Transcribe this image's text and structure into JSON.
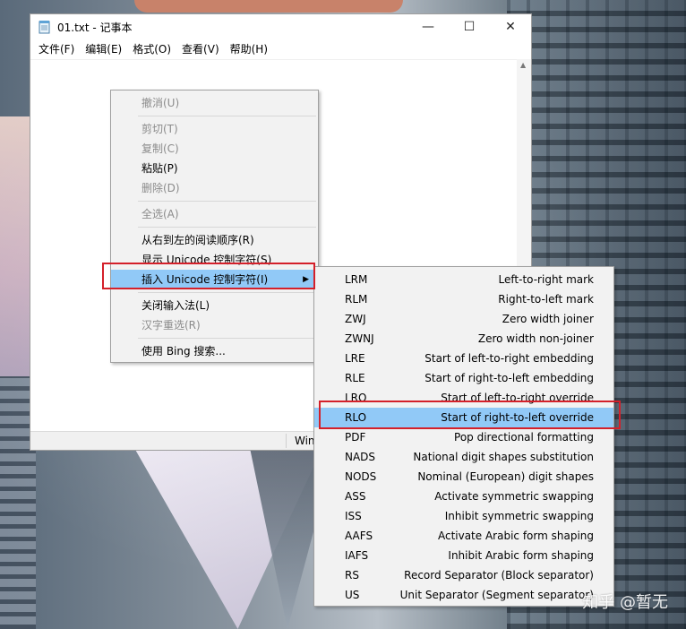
{
  "window": {
    "title": "01.txt - 记事本",
    "controls": {
      "minimize": "—",
      "maximize": "☐",
      "close": "✕"
    }
  },
  "menubar": [
    {
      "label": "文件(F)"
    },
    {
      "label": "编辑(E)"
    },
    {
      "label": "格式(O)"
    },
    {
      "label": "查看(V)"
    },
    {
      "label": "帮助(H)"
    }
  ],
  "statusbar": {
    "text": "Win"
  },
  "context_menu": {
    "items": [
      {
        "label": "撤消(U)",
        "disabled": true
      },
      {
        "label": "剪切(T)",
        "disabled": true
      },
      {
        "label": "复制(C)",
        "disabled": true
      },
      {
        "label": "粘贴(P)",
        "disabled": false
      },
      {
        "label": "删除(D)",
        "disabled": true
      },
      {
        "label": "全选(A)",
        "disabled": true
      },
      {
        "label": "从右到左的阅读顺序(R)",
        "disabled": false
      },
      {
        "label": "显示 Unicode 控制字符(S)",
        "disabled": false
      },
      {
        "label": "插入 Unicode 控制字符(I)",
        "disabled": false,
        "highlighted": true
      },
      {
        "label": "关闭输入法(L)",
        "disabled": false
      },
      {
        "label": "汉字重选(R)",
        "disabled": true
      },
      {
        "label": "使用 Bing 搜索...",
        "disabled": false
      }
    ]
  },
  "unicode_submenu": {
    "items": [
      {
        "code": "LRM",
        "desc": "Left-to-right mark"
      },
      {
        "code": "RLM",
        "desc": "Right-to-left mark"
      },
      {
        "code": "ZWJ",
        "desc": "Zero width joiner"
      },
      {
        "code": "ZWNJ",
        "desc": "Zero width non-joiner"
      },
      {
        "code": "LRE",
        "desc": "Start of left-to-right embedding"
      },
      {
        "code": "RLE",
        "desc": "Start of right-to-left embedding"
      },
      {
        "code": "LRO",
        "desc": "Start of left-to-right override"
      },
      {
        "code": "RLO",
        "desc": "Start of right-to-left override",
        "highlighted": true
      },
      {
        "code": "PDF",
        "desc": "Pop directional formatting"
      },
      {
        "code": "NADS",
        "desc": "National digit shapes substitution"
      },
      {
        "code": "NODS",
        "desc": "Nominal (European) digit shapes"
      },
      {
        "code": "ASS",
        "desc": "Activate symmetric swapping"
      },
      {
        "code": "ISS",
        "desc": "Inhibit symmetric swapping"
      },
      {
        "code": "AAFS",
        "desc": "Activate Arabic form shaping"
      },
      {
        "code": "IAFS",
        "desc": "Inhibit Arabic form shaping"
      },
      {
        "code": "RS",
        "desc": "Record Separator (Block separator)"
      },
      {
        "code": "US",
        "desc": "Unit Separator (Segment separator)"
      }
    ]
  },
  "watermark": "知乎 @暂无",
  "colors": {
    "highlight": "#91c9f7",
    "annotation_box": "#d4202a"
  }
}
